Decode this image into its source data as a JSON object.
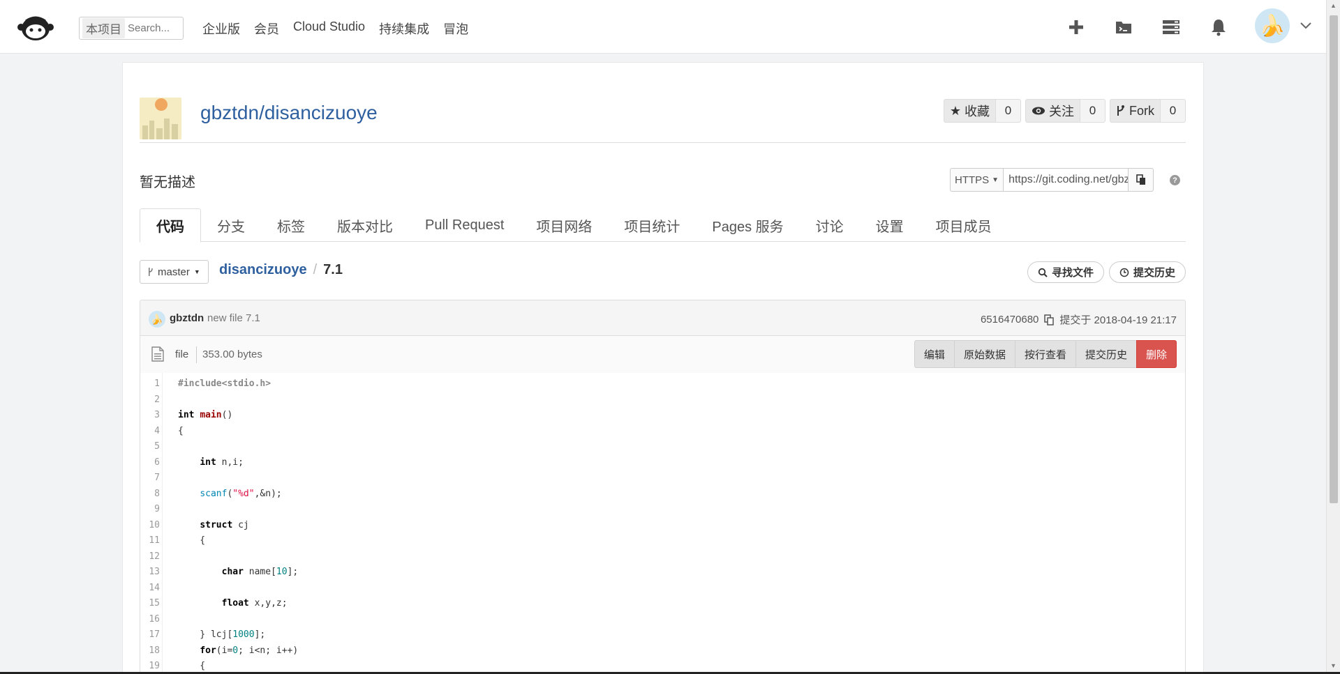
{
  "topbar": {
    "search_scope": "本项目",
    "search_placeholder": "Search...",
    "nav": [
      "企业版",
      "会员",
      "Cloud Studio",
      "持续集成",
      "冒泡"
    ]
  },
  "repo": {
    "full_name": "gbztdn/disancizuoye",
    "star_label": "收藏",
    "star_count": "0",
    "watch_label": "关注",
    "watch_count": "0",
    "fork_label": "Fork",
    "fork_count": "0",
    "description": "暂无描述",
    "clone_protocol": "HTTPS",
    "clone_url": "https://git.coding.net/gbztdn/disancizuoye.git",
    "help": "?"
  },
  "tabs": [
    "代码",
    "分支",
    "标签",
    "版本对比",
    "Pull Request",
    "项目网络",
    "项目统计",
    "Pages 服务",
    "讨论",
    "设置",
    "项目成员"
  ],
  "breadcrumb": {
    "branch": "master",
    "repo": "disancizuoye",
    "separator": "/",
    "current": "7.1",
    "find_file": "寻找文件",
    "history": "提交历史"
  },
  "commit": {
    "author": "gbztdn",
    "message": "new file 7.1",
    "hash": "6516470680",
    "committed_label": "提交于 2018-04-19 21:17"
  },
  "file": {
    "type": "file",
    "size": "353.00 bytes",
    "actions": [
      "编辑",
      "原始数据",
      "按行查看",
      "提交历史"
    ],
    "delete_label": "删除"
  },
  "code": {
    "line_numbers": [
      "1",
      "2",
      "3",
      "4",
      "5",
      "6",
      "7",
      "8",
      "9",
      "10",
      "11",
      "12",
      "13",
      "14",
      "15",
      "16",
      "17",
      "18",
      "19"
    ]
  },
  "colors": {
    "link": "#2e5f9f",
    "danger": "#d9534f"
  }
}
